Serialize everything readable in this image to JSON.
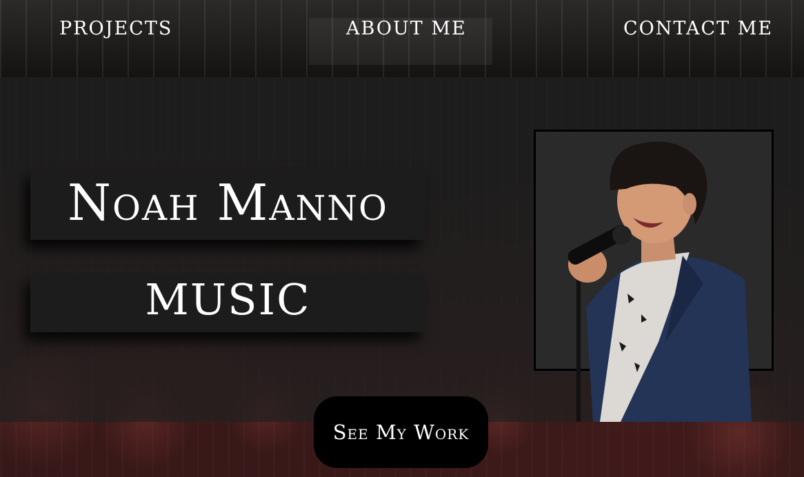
{
  "nav": {
    "projects": "PROJECTS",
    "about": "ABOUT ME",
    "contact": "CONTACT ME"
  },
  "hero": {
    "title_line1": "Noah Manno",
    "title_line2": "music",
    "cta_label": "See My Work"
  },
  "colors": {
    "panel": "#1c1c1c",
    "overlay": "#1e1e1e",
    "cta_bg": "#000000",
    "jacket": "#233457",
    "text": "#ffffff"
  },
  "icons": [
    "singer-photo"
  ]
}
